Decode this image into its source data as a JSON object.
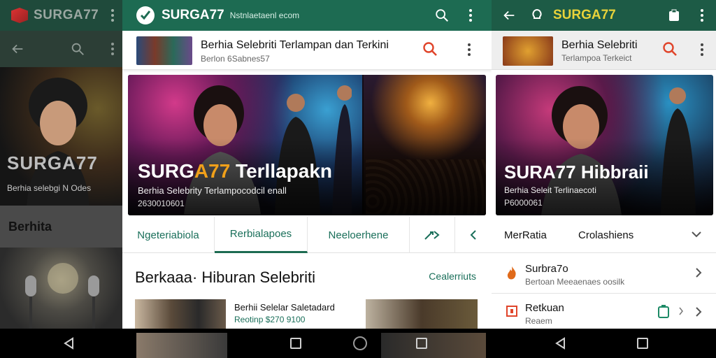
{
  "left": {
    "brand": "SURGA77",
    "hero_title": "SURGA77",
    "hero_sub": "Berhia selebgi   N Odes",
    "section_title": "Berhita"
  },
  "mid": {
    "brand": "SURGA77",
    "tagline": "Nstnlaetaenl ecom",
    "header_title": "Berhia Selebriti Terlampan dan Terkini",
    "header_sub": "Berlon 6Sabnes57",
    "hero_title_a": "SURG",
    "hero_title_b": "A77",
    "hero_title_c": " Terllapakn",
    "hero_sub": "Berhia Selebrity Terlampocodcil enall",
    "hero_date": "2630010601",
    "tabs": [
      "Ngeteriabiola",
      "Rerbialapoes",
      "Neeloerhene"
    ],
    "section_title": "Berkaaa· Hiburan Selebriti",
    "section_link": "Cealerriuts",
    "card_title": "Berhii Selelar Saletadard",
    "card_meta": "Reotinp  $270  9100"
  },
  "right": {
    "brand": "SURGA77",
    "header_title": "Berhia Selebriti",
    "header_sub": "Terlampoa Terkeict",
    "hero_title": "SURA77 Hibbraii",
    "hero_sub": "Berhia Seleit Terlinaecoti",
    "hero_date": "P6000061",
    "tab1": "MerRatia",
    "tab2": "Crolashiens",
    "row1_title": "Surbra7o",
    "row1_sub": "Bertoan Meeaenaes oosilk",
    "row2_title": "Retkuan",
    "row2_sub": "Reaem"
  },
  "colors": {
    "primary": "#1d6b52",
    "accent": "#f0a01a",
    "search": "#e0442a",
    "brand_yellow": "#e8d23a"
  },
  "icons": [
    "menu-dots-icon",
    "search-icon",
    "back-arrow-icon",
    "lightbulb-icon",
    "clipboard-icon",
    "chevron-right-icon",
    "chevron-down-icon",
    "fire-icon",
    "external-icon",
    "nav-back-icon",
    "nav-home-icon",
    "nav-recents-icon"
  ]
}
